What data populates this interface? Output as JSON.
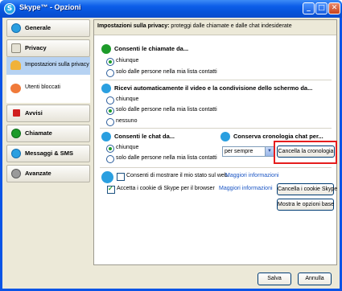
{
  "window": {
    "title": "Skype™ - Opzioni",
    "min": "_",
    "max": "□",
    "close": "✕"
  },
  "sidebar": {
    "generale": "Generale",
    "privacy": "Privacy",
    "privacy_settings": "Impostazioni sulla privacy",
    "blocked": "Utenti bloccati",
    "avvisi": "Avvisi",
    "chiamate": "Chiamate",
    "messaggi": "Messaggi & SMS",
    "avanzate": "Avanzate"
  },
  "header": {
    "title": "Impostazioni sulla privacy:",
    "subtitle": "proteggi dalle chiamate e dalle chat indesiderate"
  },
  "calls": {
    "title": "Consenti le chiamate da...",
    "options": [
      "chiunque",
      "solo dalle persone nella mia lista contatti"
    ],
    "selected": 0
  },
  "video": {
    "title": "Ricevi automaticamente il video e la condivisione dello schermo da...",
    "options": [
      "chiunque",
      "solo dalle persone nella mia lista contatti",
      "nessuno"
    ],
    "selected": 1
  },
  "chats": {
    "title": "Consenti le chat da...",
    "options": [
      "chiunque",
      "solo dalle persone nella mia lista contatti"
    ],
    "selected": 0
  },
  "history": {
    "title": "Conserva cronologia chat per...",
    "select_value": "per sempre",
    "clear_button": "Cancella la cronologia"
  },
  "web": {
    "show_status": "Consenti di mostrare il mio stato sul web.",
    "show_status_checked": false,
    "accept_cookies": "Accetta i cookie di Skype per il browser",
    "accept_cookies_checked": true,
    "more_info": "Maggiori informazioni",
    "clear_cookies_button": "Cancella i cookie Skype",
    "basic_options_button": "Mostra le opzioni base"
  },
  "footer": {
    "save": "Salva",
    "cancel": "Annulla"
  },
  "colors": {
    "accent": "#0a54e6",
    "highlight": "#e51d1d",
    "selected": "#b6d2f2"
  }
}
